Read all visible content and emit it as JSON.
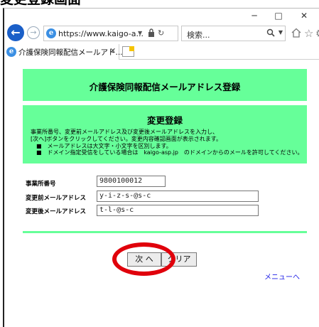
{
  "caption": "変更登録画面",
  "window": {
    "minimize": "─",
    "maximize": "□",
    "close": "✕"
  },
  "browser": {
    "url": "https://www.kaigo-a...",
    "search_placeholder": "検索...",
    "tab_title": "介護保険同報配信メールアド...",
    "back_glyph": "←",
    "forward_glyph": "→"
  },
  "page": {
    "header_title": "介護保険同報配信メールアドレス登録",
    "section_title": "変更登録",
    "instructions": [
      "事業所番号、変更前メールアドレス及び変更後メールアドレスを入力し、",
      "[次へ]ボタンをクリックしてください。変更内容確認画面が表示されます。",
      "　■　メールアドレスは大文字・小文字を区別します。",
      "　■　ドメイン指定受信をしている場合は　kaigo-asp.jp　のドメインからのメールを許可してください。"
    ],
    "fields": [
      {
        "label": "事業所番号",
        "value": "9800100012"
      },
      {
        "label": "変更前メールアドレス",
        "value": "y-i-z-s-@s-c"
      },
      {
        "label": "変更後メールアドレス",
        "value": "t-l-@s-c"
      }
    ],
    "next_button": "次 へ",
    "clear_button": "クリア",
    "menu_link": "メニューへ"
  },
  "colors": {
    "panel_green": "#66ff99",
    "highlight_red": "#e0000b",
    "link_blue": "#1a1ae6"
  }
}
